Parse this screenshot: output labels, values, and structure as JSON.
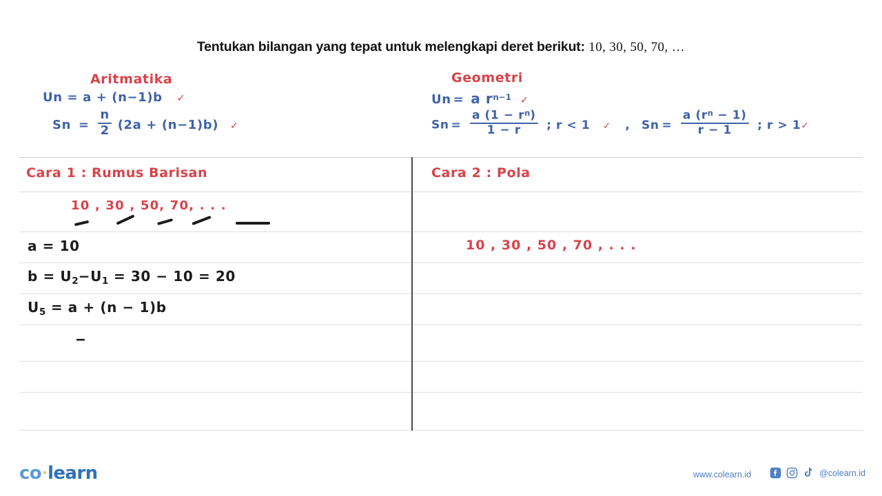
{
  "question": {
    "prompt": "Tentukan bilangan yang tepat untuk melengkapi deret berikut:",
    "series": "10, 30, 50, 70, …"
  },
  "formula_panel": {
    "arithmetic": {
      "heading": "Aritmatika",
      "un_label": "Un",
      "un_eq": "=",
      "un_body_a": "a + (n",
      "un_body_b": "1)b",
      "un_minus": "−",
      "un_check": "✓",
      "sn_label": "Sn",
      "sn_eq": "=",
      "sn_num": "n",
      "sn_den": "2",
      "sn_body_a": "(2a + (n",
      "sn_minus": "−",
      "sn_body_b": "1)b)",
      "sn_check": "✓"
    },
    "geometric": {
      "heading": "Geometri",
      "un_label": "Un",
      "un_eq": "=",
      "un_body": "a r",
      "un_exp": "n−1",
      "un_check": "✓",
      "sn_label": "Sn",
      "sn_eq": "=",
      "sn1_num_a": "a (1 − r",
      "sn1_num_exp": "n",
      "sn1_num_b": ")",
      "sn1_den": "1 − r",
      "sn1_cond": "; r < 1",
      "sn1_check": "✓",
      "comma": ",",
      "sn2_label": "Sn",
      "sn2_eq": "=",
      "sn2_num_a": "a (r",
      "sn2_num_exp": "n",
      "sn2_num_b": " − 1)",
      "sn2_den": "r − 1",
      "sn2_cond": "; r > 1",
      "sn2_check": "✓"
    }
  },
  "work_left": {
    "method_title": "Cara 1  :  Rumus Barisan",
    "series_line": "10 , 30 , 50, 70,  . . .",
    "line_a": "a = 10",
    "line_b_pre": "b = U",
    "line_b_sub1": "2",
    "line_b_mid": "−U",
    "line_b_sub2": "1",
    "line_b_post": " = 30 − 10 = 20",
    "line_u5_pre": "U",
    "line_u5_sub": "5",
    "line_u5_post": " =  a + (n − 1)b",
    "line_dash": "‒"
  },
  "work_right": {
    "method_title": "Cara 2  :  Pola",
    "series_line": "10    ,  30  ,  50    ,  70  ,  . . ."
  },
  "footer": {
    "logo_co": "co",
    "logo_dot": "·",
    "logo_learn": "learn",
    "url": "www.colearn.id",
    "handle": "@colearn.id",
    "icons": [
      "facebook-icon",
      "instagram-icon",
      "tiktok-icon"
    ]
  },
  "colors": {
    "red": "#d8424a",
    "blue": "#3e61a8",
    "black": "#1b1b1b",
    "rule": "#dedede",
    "brand_blue": "#2f72b8",
    "brand_light_blue": "#5b9bd8",
    "brand_accent": "#e8c14a",
    "social_blue": "#4f7ec4"
  }
}
